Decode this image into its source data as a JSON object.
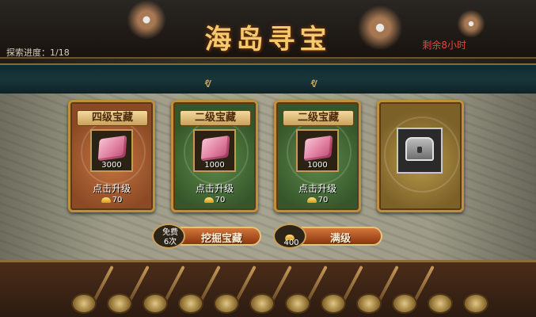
{
  "header": {
    "title": "海岛寻宝",
    "progress": "探索进度：1/18",
    "time_left": "剩余8小时"
  },
  "cards": [
    {
      "tier": "四级宝藏",
      "amount": "3000",
      "action": "点击升级",
      "cost": "70",
      "style": "bronze"
    },
    {
      "tier": "二级宝藏",
      "amount": "1000",
      "action": "点击升级",
      "cost": "70",
      "style": "green"
    },
    {
      "tier": "二级宝藏",
      "amount": "1000",
      "action": "点击升级",
      "cost": "70",
      "style": "green"
    },
    {
      "tier": "",
      "amount": "",
      "action": "",
      "cost": "",
      "style": "gold",
      "icon": "chest-icon"
    }
  ],
  "actions": {
    "dig": {
      "badge_line1": "免费",
      "badge_line2": "6次",
      "label": "挖掘宝藏"
    },
    "max": {
      "badge_value": "400",
      "label": "满级"
    }
  },
  "colors": {
    "title": "#f4c86d",
    "timer": "#e8473b",
    "bronze_card": "#c7743f",
    "green_card": "#5f8a4a",
    "gold_card": "#b99a4a",
    "button": "#d2763a"
  }
}
